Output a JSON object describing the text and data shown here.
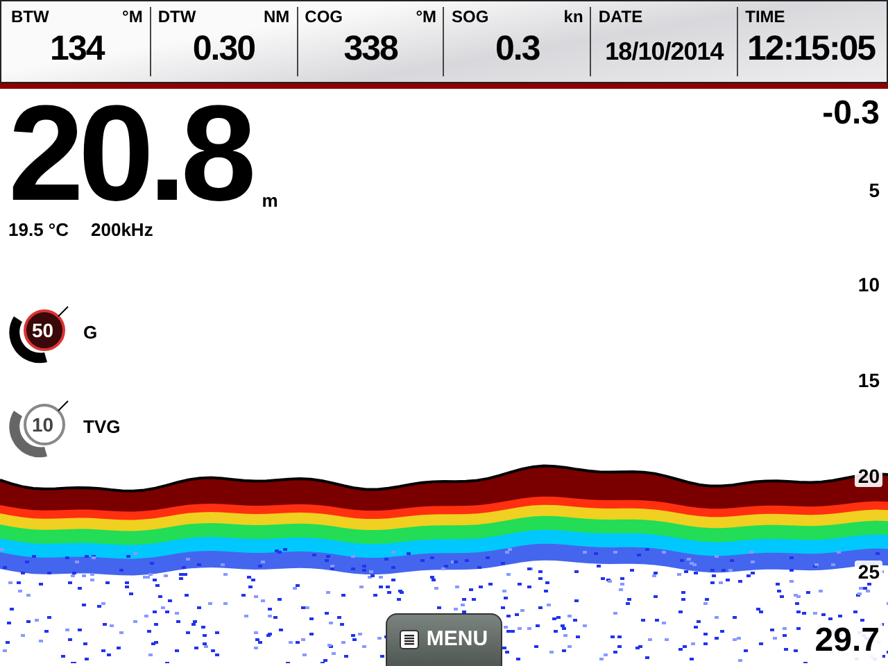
{
  "data_bar": [
    {
      "label": "BTW",
      "unit": "°M",
      "value": "134"
    },
    {
      "label": "DTW",
      "unit": "NM",
      "value": "0.30"
    },
    {
      "label": "COG",
      "unit": "°M",
      "value": "338"
    },
    {
      "label": "SOG",
      "unit": "kn",
      "value": "0.3"
    },
    {
      "label": "DATE",
      "value": "18/10/2014",
      "kind": "date"
    },
    {
      "label": "TIME",
      "value": "12:15:05",
      "kind": "time"
    }
  ],
  "depth": {
    "value": "20.8",
    "unit": "m",
    "temperature": "19.5 °C",
    "frequency": "200kHz"
  },
  "controls": [
    {
      "value": "50",
      "label": "G",
      "active": true
    },
    {
      "value": "10",
      "label": "TVG",
      "active": false
    }
  ],
  "range_scale": [
    {
      "label": "-0.3",
      "kind": "top"
    },
    {
      "label": "5"
    },
    {
      "label": "10"
    },
    {
      "label": "15"
    },
    {
      "label": "20"
    },
    {
      "label": "25"
    },
    {
      "label": "29.7",
      "kind": "bottom"
    }
  ],
  "menu_button": {
    "label": "MENU"
  }
}
